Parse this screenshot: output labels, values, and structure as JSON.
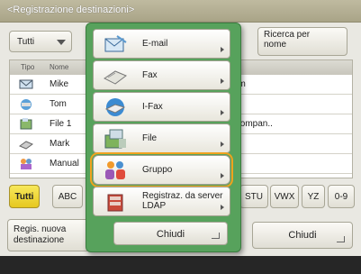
{
  "title": "<Registrazione destinazioni>",
  "filter": {
    "label": "Tutti"
  },
  "search": {
    "label": "Ricerca per nome"
  },
  "list": {
    "headers": [
      "Tipo",
      "Nome"
    ],
    "rows": [
      {
        "name": "Mike",
        "right": "om"
      },
      {
        "name": "Tom",
        "right": "n"
      },
      {
        "name": "File 1",
        "right": ".compan.."
      },
      {
        "name": "Mark",
        "right": ""
      },
      {
        "name": "Manual",
        "right": ""
      }
    ]
  },
  "alpha": [
    "Tutti",
    "ABC",
    "STU",
    "VWX",
    "YZ",
    "0-9"
  ],
  "bottom": {
    "register_label": "Regis. nuova destinazione",
    "close_label": "Chiudi"
  },
  "popup": {
    "items": [
      "E-mail",
      "Fax",
      "I-Fax",
      "File",
      "Gruppo",
      "Registraz. da server LDAP"
    ],
    "close_label": "Chiudi"
  }
}
